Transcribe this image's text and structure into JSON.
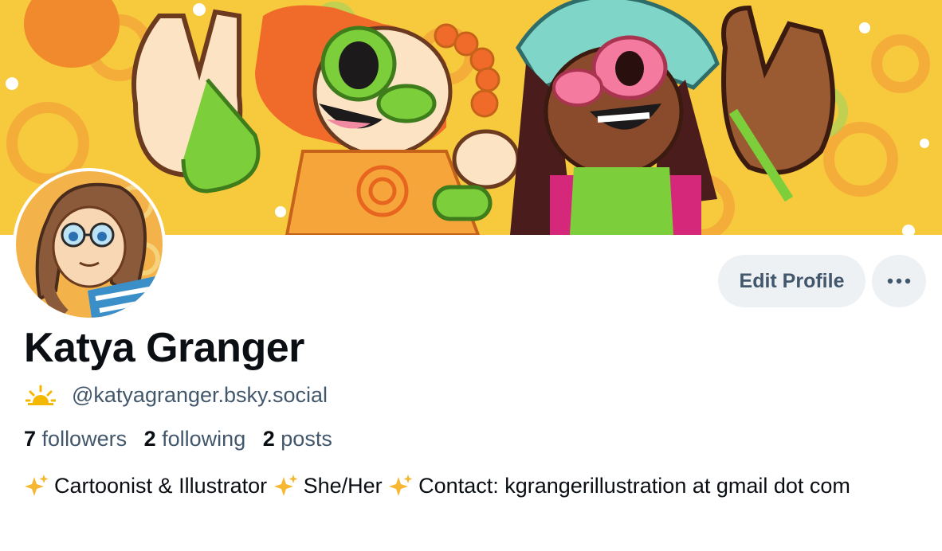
{
  "profile": {
    "display_name": "Katya Granger",
    "handle": "@katyagranger.bsky.social",
    "handle_icon": "sunrise-icon",
    "bio_segments": [
      "Cartoonist & Illustrator ",
      "She/Her ",
      "Contact: kgrangerillustration at gmail dot com"
    ],
    "bio_icon": "sparkles-icon"
  },
  "stats": {
    "followers_count": "7",
    "followers_label": "followers",
    "following_count": "2",
    "following_label": "following",
    "posts_count": "2",
    "posts_label": "posts"
  },
  "actions": {
    "edit_label": "Edit Profile",
    "more_icon": "ellipsis-icon"
  },
  "colors": {
    "banner_yellow": "#f7c93d",
    "muted_text": "#42576c",
    "button_bg": "#eef1f4"
  }
}
